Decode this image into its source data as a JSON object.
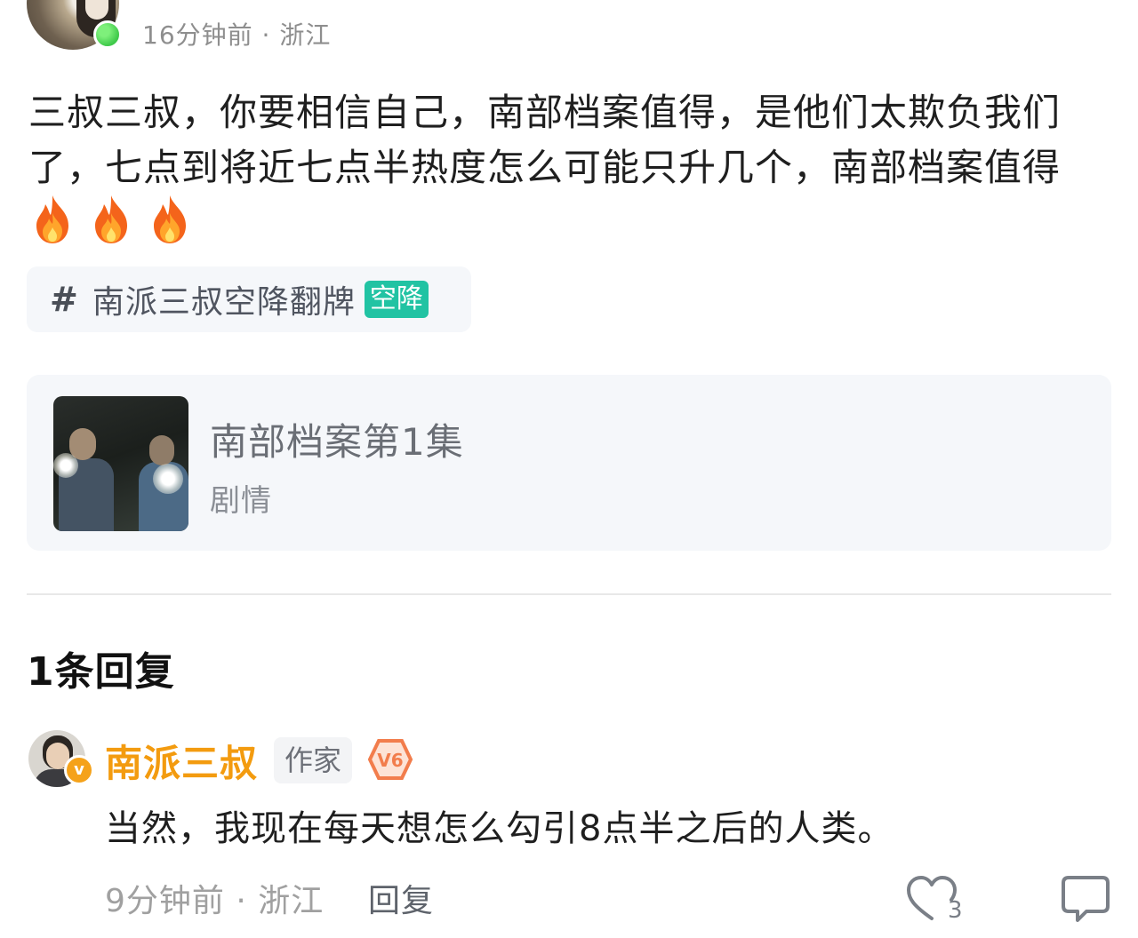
{
  "post": {
    "meta": "16分钟前 · 浙江",
    "text": "三叔三叔，你要相信自己，南部档案值得，是他们太欺负我们了，七点到将近七点半热度怎么可能只升几个，南部档案值得",
    "emoji": [
      "🔥",
      "🔥",
      "🔥"
    ],
    "topic": {
      "hash": "#",
      "label": "南派三叔空降翻牌",
      "badge": "空降",
      "badge_color": "#21c3a3"
    },
    "card": {
      "title": "南部档案第1集",
      "subtitle": "剧情"
    }
  },
  "replies": {
    "count_label": "1条回复",
    "items": [
      {
        "author": "南派三叔",
        "author_color": "#f39b0f",
        "verified_mark": "v",
        "role_tag": "作家",
        "level_badge": "V6",
        "text": "当然，我现在每天想怎么勾引8点半之后的人类。",
        "meta": "9分钟前 · 浙江",
        "reply_label": "回复",
        "likes": "3"
      }
    ]
  }
}
